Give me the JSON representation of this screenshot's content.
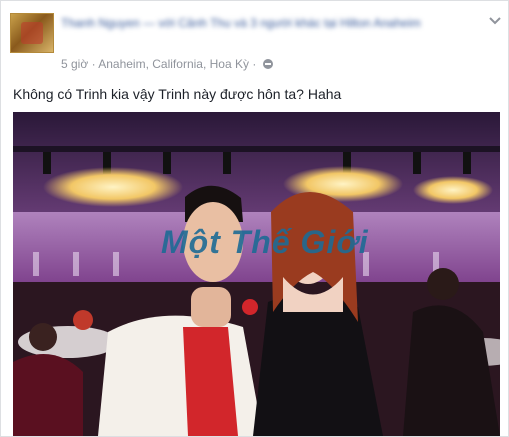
{
  "post": {
    "author_line": "Thanh Nguyen — với Cảnh Thu và 3 người khác tại Hilton Anaheim",
    "timestamp": "5 giờ",
    "location": "Anaheim, California, Hoa Kỳ",
    "separator": "·",
    "caption": "Không có Trinh kia vậy Trinh này được hôn ta? Haha",
    "watermark": "Một Thế Giới"
  },
  "icons": {
    "menu": "chevron-down-icon",
    "privacy": "globe-icon"
  },
  "colors": {
    "link": "#365899",
    "meta": "#90949c",
    "text": "#1d2129",
    "watermark": "#1e6b95"
  }
}
